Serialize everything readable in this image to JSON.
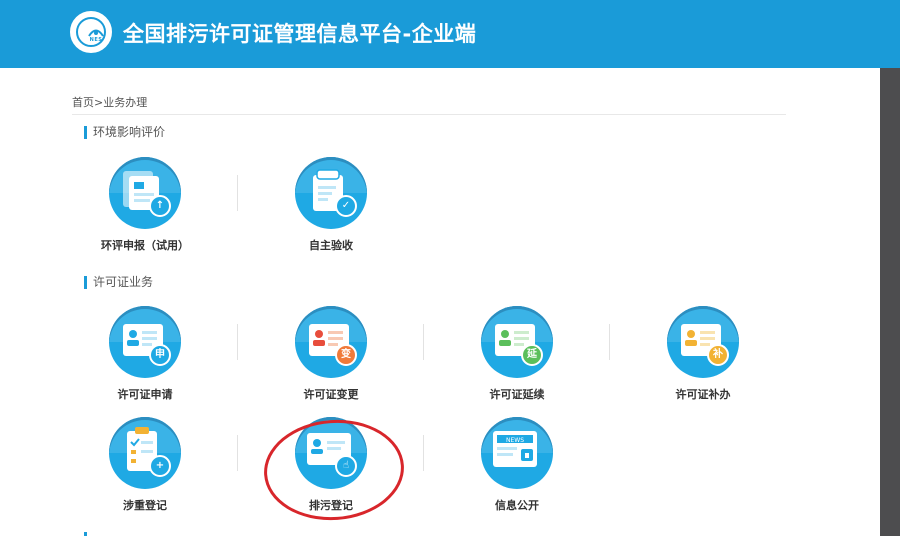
{
  "header": {
    "title": "全国排污许可证管理信息平台-企业端",
    "logo_text": "NES",
    "color": "#1a9bd8"
  },
  "breadcrumb": "首页>业务办理",
  "sections": [
    {
      "title": "环境影响评价",
      "items": [
        {
          "label": "环评申报（试用）",
          "icon": "document-upload-icon",
          "badge": "↑",
          "badge_color": "#1fa9e4"
        },
        {
          "label": "自主验收",
          "icon": "clipboard-check-icon",
          "badge": "✓",
          "badge_color": "#1fa9e4"
        }
      ]
    },
    {
      "title": "许可证业务",
      "items": [
        {
          "label": "许可证申请",
          "icon": "certificate-apply-icon",
          "badge": "申",
          "badge_color": "#1fa9e4"
        },
        {
          "label": "许可证变更",
          "icon": "certificate-change-icon",
          "badge": "变",
          "badge_color": "#f07a3a"
        },
        {
          "label": "许可证延续",
          "icon": "certificate-renew-icon",
          "badge": "延",
          "badge_color": "#5bbf5b"
        },
        {
          "label": "许可证补办",
          "icon": "certificate-reissue-icon",
          "badge": "补",
          "badge_color": "#f2b233"
        },
        {
          "label": "涉重登记",
          "icon": "checklist-add-icon",
          "badge": "+",
          "badge_color": "#1fa9e4"
        },
        {
          "label": "排污登记",
          "icon": "id-card-hand-icon",
          "badge": "☝",
          "badge_color": "#1fa9e4"
        },
        {
          "label": "信息公开",
          "icon": "news-lock-icon",
          "badge": "NEWS",
          "badge_color": "#1fa9e4"
        }
      ]
    }
  ]
}
